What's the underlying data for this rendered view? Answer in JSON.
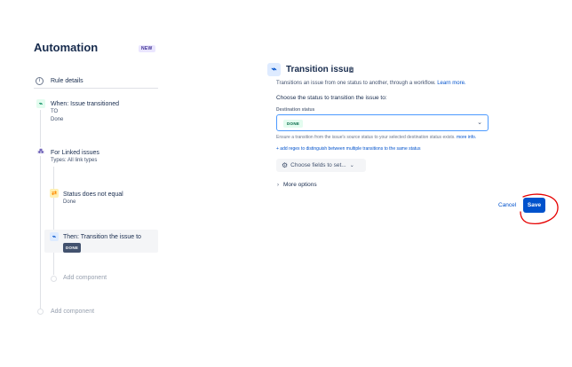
{
  "sidebar": {
    "title": "Automation",
    "badge": "NEW",
    "rule_details": "Rule details",
    "trigger": {
      "title": "When: Issue transitioned",
      "to_label": "TO",
      "to_value": "Done"
    },
    "branch": {
      "title": "For Linked issues",
      "subtitle": "Types: All link types"
    },
    "condition": {
      "title": "Status does not equal",
      "value": "Done"
    },
    "action": {
      "title": "Then: Transition the issue to",
      "status": "DONE"
    },
    "add_component_inner": "Add component",
    "add_component_outer": "Add component"
  },
  "panel": {
    "title": "Transition issue",
    "description": "Transitions an issue from one status to another, through a workflow.",
    "learn_more": "Learn more.",
    "choose": "Choose the status to transition the issue to:",
    "destination_label": "Destination status",
    "destination_value": "DONE",
    "ensure_text": "Ensure a transition from the issue's source status to your selected destination status exists.",
    "ensure_link": "more info.",
    "regex_link": "+ add regex to distinguish between multiple transitions to the same status",
    "choose_fields": "Choose fields to set...",
    "more_options": "More options",
    "cancel": "Cancel",
    "save": "Save"
  },
  "colors": {
    "primary": "#0052cc",
    "annotation": "#e60000"
  }
}
